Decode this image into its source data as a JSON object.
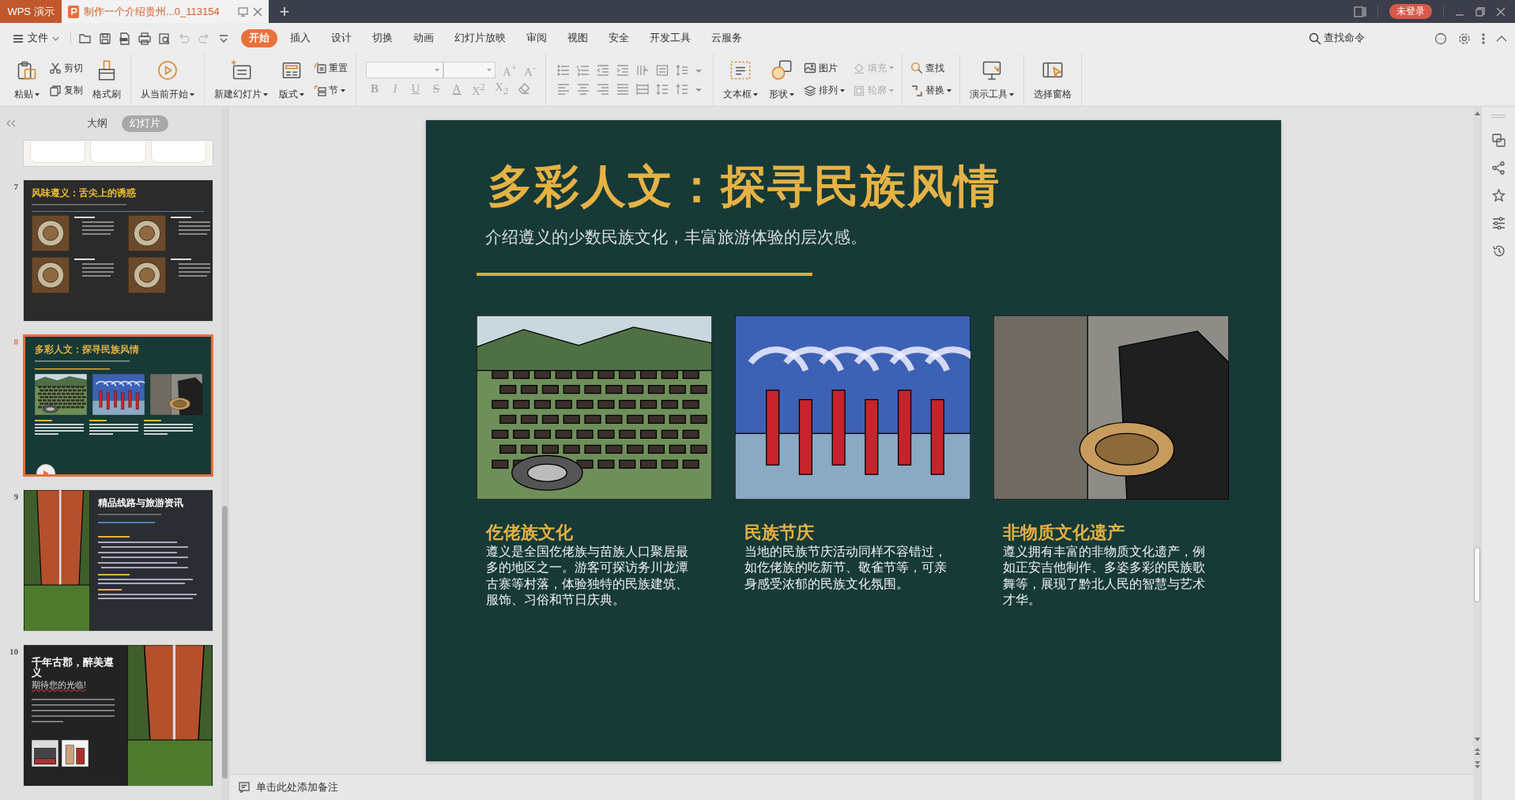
{
  "title_bar": {
    "app_tab": "WPS 演示",
    "doc_tab": {
      "title": "制作一个介绍贵州...0_113154",
      "selected": true
    },
    "new_tab": "+",
    "login_badge": "未登录"
  },
  "menu_bar": {
    "file_menu": "文件",
    "tabs": [
      {
        "label": "开始",
        "selected": true
      },
      {
        "label": "插入",
        "selected": false
      },
      {
        "label": "设计",
        "selected": false
      },
      {
        "label": "切换",
        "selected": false
      },
      {
        "label": "动画",
        "selected": false
      },
      {
        "label": "幻灯片放映",
        "selected": false
      },
      {
        "label": "审阅",
        "selected": false
      },
      {
        "label": "视图",
        "selected": false
      },
      {
        "label": "安全",
        "selected": false
      },
      {
        "label": "开发工具",
        "selected": false
      },
      {
        "label": "云服务",
        "selected": false
      }
    ],
    "search_command": "查找命令"
  },
  "ribbon": {
    "groups": [
      {
        "kind": "commands",
        "columns": [
          {
            "kind": "large",
            "items": [
              {
                "label": "粘贴",
                "dropdown": true,
                "disabled": false
              }
            ]
          },
          {
            "kind": "stack",
            "items": [
              {
                "label": "剪切",
                "dropdown": false,
                "disabled": false
              },
              {
                "label": "复制",
                "dropdown": false,
                "disabled": false
              }
            ]
          },
          {
            "kind": "large",
            "items": [
              {
                "label": "格式刷",
                "dropdown": false,
                "disabled": false
              }
            ]
          }
        ]
      },
      {
        "kind": "commands",
        "columns": [
          {
            "kind": "large",
            "items": [
              {
                "label": "从当前开始",
                "dropdown": true,
                "disabled": false
              }
            ]
          }
        ]
      },
      {
        "kind": "commands",
        "columns": [
          {
            "kind": "large",
            "items": [
              {
                "label": "新建幻灯片",
                "dropdown": true,
                "disabled": false
              }
            ]
          },
          {
            "kind": "large",
            "items": [
              {
                "label": "版式",
                "dropdown": true,
                "disabled": false
              }
            ]
          },
          {
            "kind": "stack",
            "items": [
              {
                "label": "重置",
                "dropdown": false,
                "disabled": false
              },
              {
                "label": "节",
                "dropdown": true,
                "disabled": false
              }
            ]
          }
        ]
      },
      {
        "kind": "font",
        "size_buttons": [
          {
            "glyph": "A$^{+}$",
            "disabled": true
          },
          {
            "glyph": "A$^{-}$",
            "disabled": true
          }
        ],
        "format_buttons": [
          {
            "glyph": "B",
            "kind": "bold",
            "disabled": true
          },
          {
            "glyph": "I",
            "kind": "italic",
            "disabled": true
          },
          {
            "glyph": "U",
            "kind": "underline",
            "disabled": true
          },
          {
            "glyph": "S",
            "kind": "strike",
            "disabled": true
          },
          {
            "glyph": "A",
            "kind": "color",
            "disabled": true
          },
          {
            "glyph": "X$^{2}$",
            "kind": "plain",
            "disabled": true
          },
          {
            "glyph": "X$_{2}$",
            "kind": "plain",
            "disabled": true
          }
        ]
      },
      {
        "kind": "paragraph"
      },
      {
        "kind": "commands",
        "columns": [
          {
            "kind": "large",
            "items": [
              {
                "label": "文本框",
                "dropdown": true,
                "disabled": false
              }
            ]
          },
          {
            "kind": "large",
            "items": [
              {
                "label": "形状",
                "dropdown": true,
                "disabled": false
              }
            ]
          },
          {
            "kind": "stack",
            "items": [
              {
                "label": "图片",
                "dropdown": false,
                "disabled": false
              },
              {
                "label": "排列",
                "dropdown": true,
                "disabled": false
              }
            ]
          },
          {
            "kind": "stack",
            "items": [
              {
                "label": "填充",
                "dropdown": true,
                "disabled": true
              },
              {
                "label": "轮廓",
                "dropdown": true,
                "disabled": true
              }
            ]
          }
        ]
      },
      {
        "kind": "commands",
        "columns": [
          {
            "kind": "stack",
            "items": [
              {
                "label": "查找",
                "dropdown": false,
                "disabled": false
              },
              {
                "label": "替换",
                "dropdown": true,
                "disabled": false
              }
            ]
          }
        ]
      },
      {
        "kind": "commands",
        "columns": [
          {
            "kind": "large",
            "items": [
              {
                "label": "演示工具",
                "dropdown": true,
                "disabled": false
              }
            ]
          }
        ]
      },
      {
        "kind": "commands",
        "columns": [
          {
            "kind": "large",
            "items": [
              {
                "label": "选择窗格",
                "dropdown": false,
                "disabled": false
              }
            ]
          }
        ]
      }
    ]
  },
  "slide_panel": {
    "view_tabs": [
      {
        "label": "大纲",
        "selected": false
      },
      {
        "label": "幻灯片",
        "selected": true
      }
    ],
    "slides": [
      {
        "kind": "cards",
        "selected": false
      },
      {
        "kind": "food",
        "number": "7",
        "title": "风味遵义：舌尖上的诱惑",
        "selected": false
      },
      {
        "kind": "culture",
        "number": "8",
        "title": "多彩人文：探寻民族风情",
        "selected": true
      },
      {
        "kind": "route",
        "number": "9",
        "title": "精品线路与旅游资讯",
        "selected": false
      },
      {
        "kind": "closing",
        "number": "10",
        "title": "千年古郡，醉美遵义",
        "subtitle": "期待您的光临!",
        "selected": false
      }
    ]
  },
  "slide": {
    "title": "多彩人文：探寻民族风情",
    "subtitle": "介绍遵义的少数民族文化，丰富旅游体验的层次感。",
    "sections": [
      {
        "kind": "village",
        "heading": "仡佬族文化",
        "body": "遵义是全国仡佬族与苗族人口聚居最多的地区之一。游客可探访务川龙潭古寨等村落，体验独特的民族建筑、服饰、习俗和节日庆典。"
      },
      {
        "kind": "festival",
        "heading": "民族节庆",
        "body": "当地的民族节庆活动同样不容错过，如仡佬族的吃新节、敬雀节等，可亲身感受浓郁的民族文化氛围。"
      },
      {
        "kind": "craft",
        "heading": "非物质文化遗产",
        "body": "遵义拥有丰富的非物质文化遗产，例如正安吉他制作、多姿多彩的民族歌舞等，展现了黔北人民的智慧与艺术才华。"
      }
    ]
  },
  "notes": {
    "prompt": "单击此处添加备注"
  }
}
